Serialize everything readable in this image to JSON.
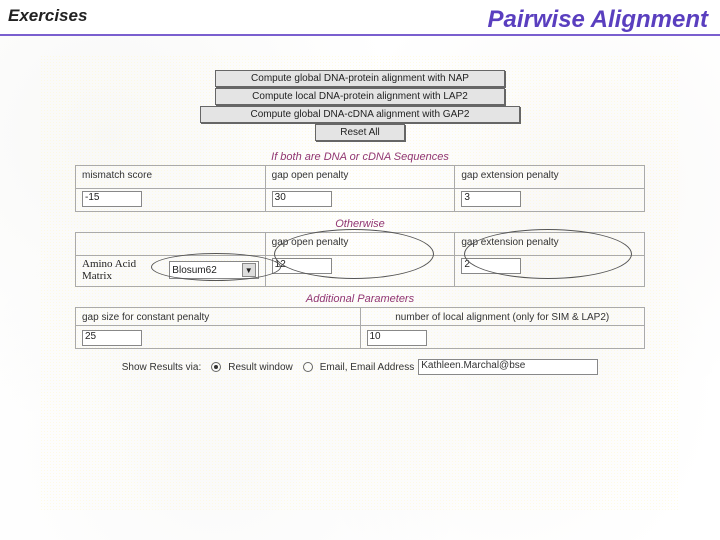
{
  "header": {
    "left": "Exercises",
    "right": "Pairwise Alignment"
  },
  "buttons": {
    "compute_global_dna_protein": "Compute global DNA-protein alignment with NAP",
    "compute_local_dna_protein": "Compute local DNA-protein alignment with LAP2",
    "compute_global_dna_cdna": "Compute global DNA-cDNA alignment with GAP2",
    "reset_all": "Reset All"
  },
  "sections": {
    "dna_cdna": "If both are DNA or cDNA Sequences",
    "otherwise": "Otherwise",
    "additional": "Additional Parameters"
  },
  "dna_block": {
    "mismatch_label": "mismatch score",
    "mismatch_value": "-15",
    "gap_open_label": "gap open penalty",
    "gap_open_value": "30",
    "gap_ext_label": "gap extension penalty",
    "gap_ext_value": "3"
  },
  "otherwise_block": {
    "matrix_label": "Amino Acid Matrix",
    "matrix_value": "Blosum62",
    "gap_open_label": "gap open penalty",
    "gap_open_value": "12",
    "gap_ext_label": "gap extension penalty",
    "gap_ext_value": "2"
  },
  "additional_block": {
    "gap_size_label": "gap size for constant penalty",
    "gap_size_value": "25",
    "num_align_label": "number of local alignment (only for SIM & LAP2)",
    "num_align_value": "10"
  },
  "results": {
    "label": "Show Results via:",
    "opt_window": "Result window",
    "opt_email": "Email, Email Address",
    "email_value": "Kathleen.Marchal@bse"
  }
}
